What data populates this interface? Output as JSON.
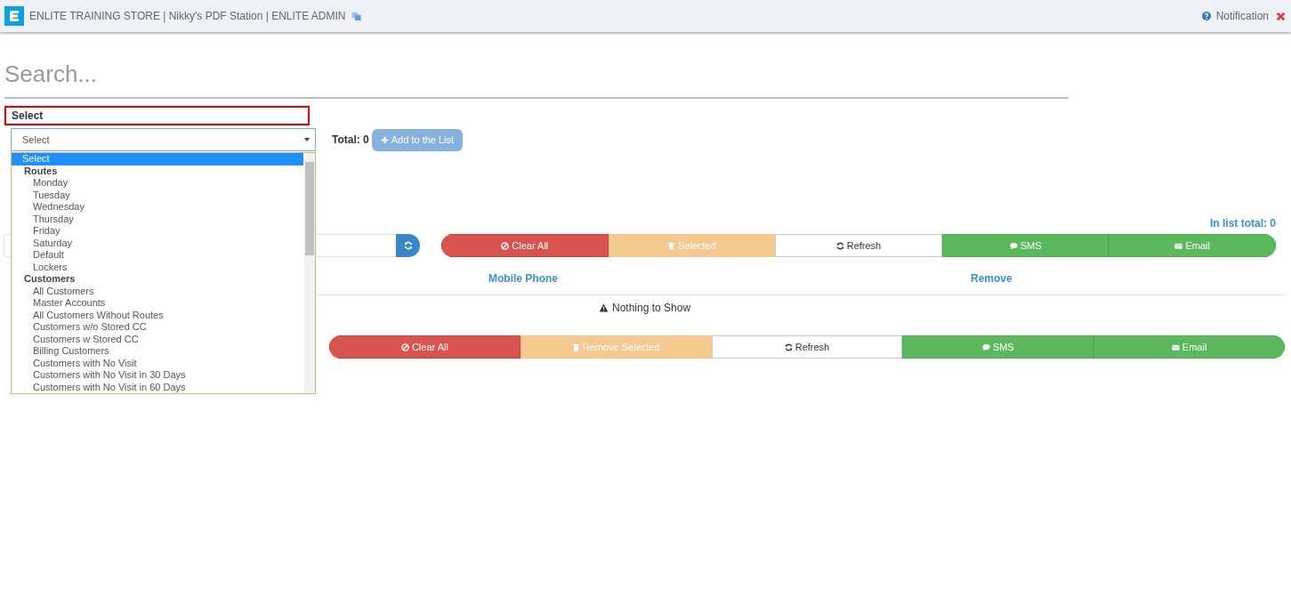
{
  "header": {
    "title": "ENLITE TRAINING STORE | Nikky's PDF Station | ENLITE ADMIN",
    "notification": "Notification"
  },
  "search": {
    "placeholder": "Search..."
  },
  "select_label": "Select",
  "select": {
    "value": "Select",
    "total": "Total: 0",
    "add_button": "Add to the List"
  },
  "dropdown": [
    {
      "kind": "option",
      "label": "Select",
      "selected": true
    },
    {
      "kind": "group",
      "label": "Routes",
      "children": [
        {
          "label": "Monday",
          "selected": false
        },
        {
          "label": "Tuesday",
          "selected": false
        },
        {
          "label": "Wednesday",
          "selected": false
        },
        {
          "label": "Thursday",
          "selected": false
        },
        {
          "label": "Friday",
          "selected": false
        },
        {
          "label": "Saturday",
          "selected": false
        },
        {
          "label": "Default",
          "selected": false
        },
        {
          "label": "Lockers",
          "selected": false
        }
      ]
    },
    {
      "kind": "group",
      "label": "Customers",
      "children": [
        {
          "label": "All Customers",
          "selected": false
        },
        {
          "label": "Master Accounts",
          "selected": false
        },
        {
          "label": "All Customers Without Routes",
          "selected": false
        },
        {
          "label": "Customers w/o Stored CC",
          "selected": false
        },
        {
          "label": "Customers w Stored CC",
          "selected": false
        },
        {
          "label": "Billing Customers",
          "selected": false
        },
        {
          "label": "Customers with No Visit",
          "selected": false
        },
        {
          "label": "Customers with No Visit in 30 Days",
          "selected": false
        },
        {
          "label": "Customers with No Visit in 60 Days",
          "selected": false
        }
      ]
    }
  ],
  "in_list_total": "In list total: 0",
  "toolbar_top": [
    {
      "kind": "danger",
      "label": "Clear All"
    },
    {
      "kind": "warning",
      "label": "Selected"
    },
    {
      "kind": "default",
      "label": "Refresh"
    },
    {
      "kind": "sms",
      "label": "SMS"
    },
    {
      "kind": "email",
      "label": "Email"
    }
  ],
  "table": {
    "columns": [
      "Mobile Phone",
      "Remove"
    ],
    "empty_message": "Nothing to Show"
  },
  "toolbar_bottom": [
    {
      "kind": "danger",
      "label": "Clear All"
    },
    {
      "kind": "warning",
      "label": "Remove Selected"
    },
    {
      "kind": "default",
      "label": "Refresh"
    },
    {
      "kind": "sms",
      "label": "SMS"
    },
    {
      "kind": "email",
      "label": "Email"
    }
  ]
}
